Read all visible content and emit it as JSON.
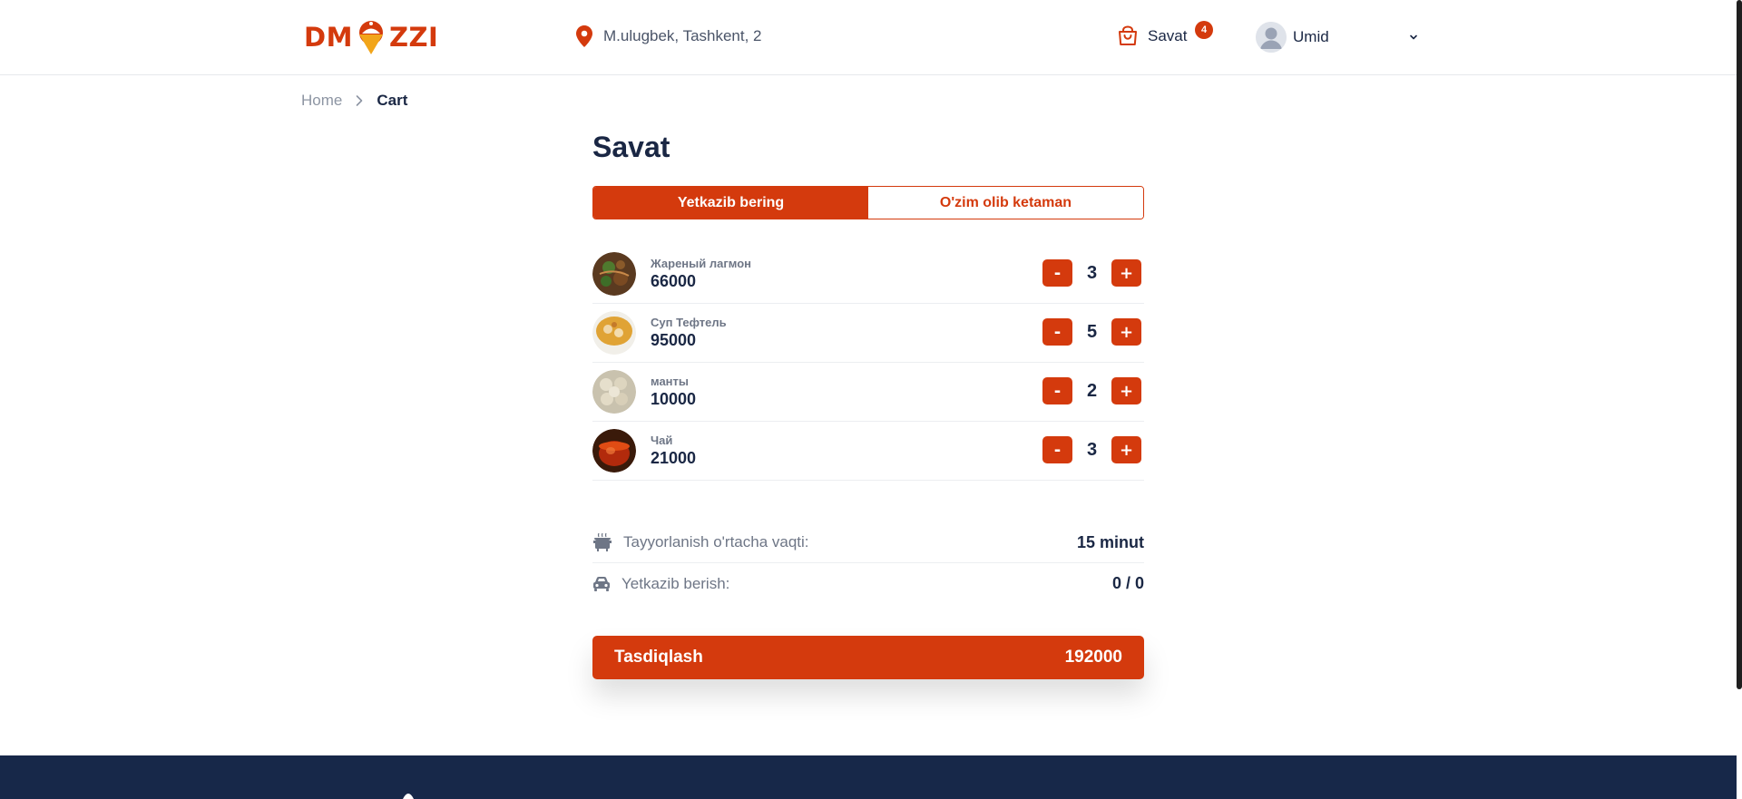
{
  "header": {
    "logo_text_left": "DM",
    "logo_text_right": "ZZI",
    "location": "M.ulugbek, Tashkent, 2",
    "cart_label": "Savat",
    "cart_count": "4",
    "user_name": "Umid"
  },
  "breadcrumb": {
    "home": "Home",
    "current": "Cart"
  },
  "page": {
    "title": "Savat",
    "tabs": [
      {
        "label": "Yetkazib bering",
        "active": true
      },
      {
        "label": "O'zim olib ketaman",
        "active": false
      }
    ]
  },
  "items": [
    {
      "name": "Жареный лагмон",
      "price": "66000",
      "qty": "3",
      "minus": "-",
      "plus": "+"
    },
    {
      "name": "Суп Тефтель",
      "price": "95000",
      "qty": "5",
      "minus": "-",
      "plus": "+"
    },
    {
      "name": "манты",
      "price": "10000",
      "qty": "2",
      "minus": "-",
      "plus": "+"
    },
    {
      "name": "Чай",
      "price": "21000",
      "qty": "3",
      "minus": "-",
      "plus": "+"
    }
  ],
  "summary": {
    "prep_label": "Tayyorlanish o'rtacha vaqti:",
    "prep_value": "15 minut",
    "delivery_label": "Yetkazib berish:",
    "delivery_value": "0 / 0"
  },
  "confirm": {
    "label": "Tasdiqlash",
    "total": "192000"
  },
  "colors": {
    "accent": "#d43a0d",
    "dark": "#1a2744",
    "footer": "#172849"
  }
}
